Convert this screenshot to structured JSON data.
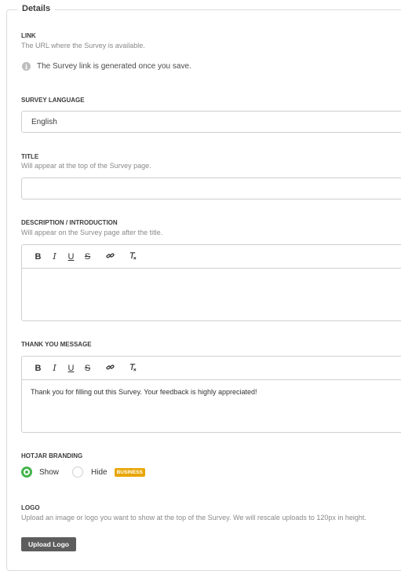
{
  "section": {
    "legend": "Details"
  },
  "link": {
    "label": "LINK",
    "help": "The URL where the Survey is available.",
    "info_icon": "info-icon",
    "info_text": "The Survey link is generated once you save."
  },
  "survey_language": {
    "label": "SURVEY LANGUAGE",
    "value": "English"
  },
  "title": {
    "label": "TITLE",
    "help": "Will appear at the top of the Survey page.",
    "value": ""
  },
  "description": {
    "label": "DESCRIPTION / INTRODUCTION",
    "help": "Will appear on the Survey page after the title.",
    "body": ""
  },
  "toolbar": {
    "bold": "B",
    "italic": "I",
    "underline": "U",
    "strike": "S",
    "link_icon": "link-icon",
    "clear_format_icon": "clear-format-icon"
  },
  "thank_you": {
    "label": "THANK YOU MESSAGE",
    "body": "Thank you for filling out this Survey. Your feedback is highly appreciated!"
  },
  "branding": {
    "label": "HOTJAR BRANDING",
    "options": [
      {
        "label": "Show",
        "selected": true
      },
      {
        "label": "Hide",
        "selected": false
      }
    ],
    "badge": "BUSINESS",
    "accent": "#42b54a",
    "badge_color": "#e8a500"
  },
  "logo": {
    "label": "LOGO",
    "help": "Upload an image or logo you want to show at the top of the Survey. We will rescale uploads to 120px in height.",
    "button": "Upload Logo"
  }
}
